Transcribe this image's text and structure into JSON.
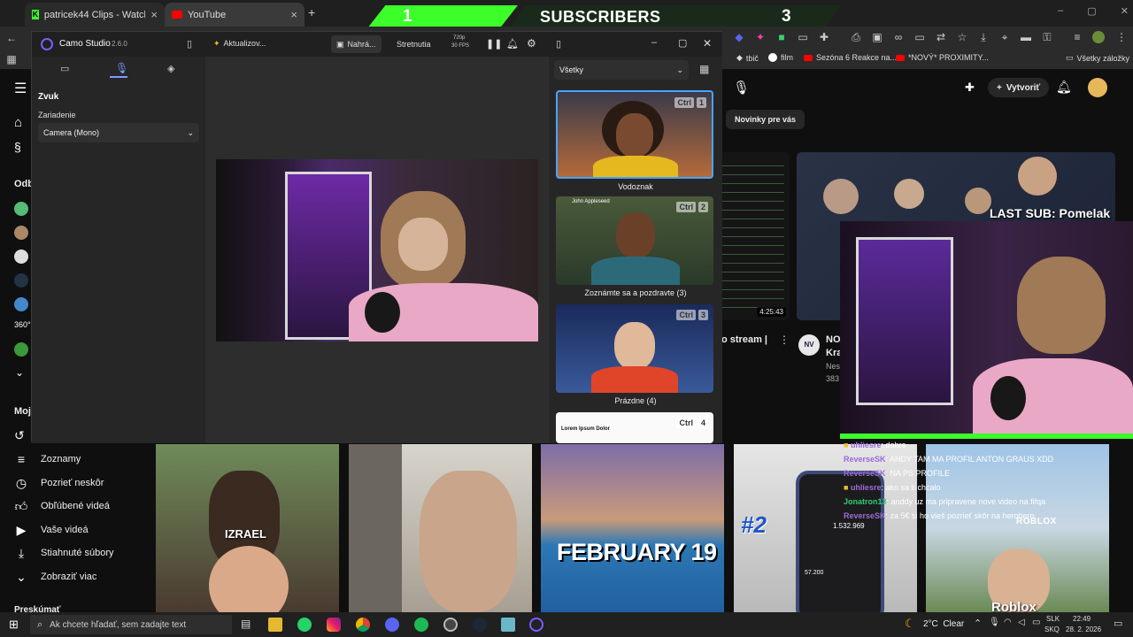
{
  "browser": {
    "tabs": [
      {
        "label": "patricek44 Clips - Watch Live o...",
        "icon": "kick-icon"
      },
      {
        "label": "YouTube",
        "icon": "youtube-icon"
      }
    ],
    "bookmarks": [
      {
        "label": "tbič"
      },
      {
        "label": "film"
      },
      {
        "label": "Sezóna 6 Reakce na..."
      },
      {
        "label": "*NOVÝ* PROXIMITY..."
      },
      {
        "label": "Všetky záložky"
      }
    ]
  },
  "sub_banner": {
    "left": "1",
    "label": "SUBSCRIBERS",
    "right": "3"
  },
  "camo": {
    "title": "Camo Studio",
    "version": "2.6.0",
    "update": "Aktualizov...",
    "record": "Nahrá...",
    "meetings": "Stretnutia",
    "resolution": "720p",
    "fps": "30 FPS",
    "section": "Zvuk",
    "device_label": "Zariadenie",
    "device_value": "Camera (Mono)",
    "filter": "Všetky",
    "scenes": [
      {
        "label": "Vodoznak",
        "key": "1"
      },
      {
        "label": "Zoznámte sa a pozdravte (3)",
        "key": "2",
        "name": "John Appleseed"
      },
      {
        "label": "Prázdne (4)",
        "key": "3"
      },
      {
        "label": "",
        "key": "4",
        "text": "Lorem Ipsum Dolor"
      }
    ],
    "ctrl": "Ctrl"
  },
  "youtube": {
    "chip": "Novinky pre vás",
    "create": "Vytvoriť",
    "sidebar_heading": "Odb",
    "mine_heading": "Moj",
    "explore_heading": "Preskúmať",
    "menu": [
      {
        "label": "Zoznamy",
        "icon": "list-icon"
      },
      {
        "label": "Pozrieť neskôr",
        "icon": "clock-icon"
      },
      {
        "label": "Obľúbené videá",
        "icon": "thumbs-up-icon"
      },
      {
        "label": "Vaše videá",
        "icon": "play-square-icon"
      },
      {
        "label": "Stiahnuté súbory",
        "icon": "download-icon"
      },
      {
        "label": "Zobraziť viac",
        "icon": "chevron-down-icon"
      }
    ],
    "video_duration": "4:25:43",
    "video_title_partial": "o stream |",
    "video2_title_partial": "NO",
    "video2_line2": "Kra",
    "video2_channel": "Nes",
    "video2_views": "383",
    "channel_initials": "NV"
  },
  "stream_overlay": {
    "last_sub": "LAST SUB: Pomelak"
  },
  "chat": [
    {
      "user": "uhliesre",
      "msg": ": dobre"
    },
    {
      "user": "ReverseSK",
      "msg": ": ANDY TAM MA PROFIL ANTON GRAUS XDD"
    },
    {
      "user": "ReverseSK",
      "msg": ": NA PS PROFILE"
    },
    {
      "user": "uhliesre",
      "msg": ": ako sa ti chcalo"
    },
    {
      "user": "Jonatron13",
      "msg": ": anddy uz ma pripravene nove video na fifqa"
    },
    {
      "user": "ReverseSK",
      "msg": ": za 5€ si ho vieš pozrieť skôr na herohero"
    }
  ],
  "shorts": [
    {
      "text": "IZRAEL"
    },
    {
      "text": ""
    },
    {
      "text": "FEBRUARY 19"
    },
    {
      "text": "#2",
      "screen_number": "1.532.969",
      "small_number": "57.200"
    },
    {
      "text": "Roblox",
      "sign": "ROBLOX"
    }
  ],
  "taskbar": {
    "search_placeholder": "Ak chcete hľadať, sem zadajte text",
    "weather": "2°C  Clear",
    "lang1": "SLK",
    "lang2": "SKQ",
    "time": "22:49",
    "date": "28. 2. 2026"
  },
  "colors": {
    "accent_green": "#3cff2a",
    "camo_purple": "#7b5cff"
  }
}
